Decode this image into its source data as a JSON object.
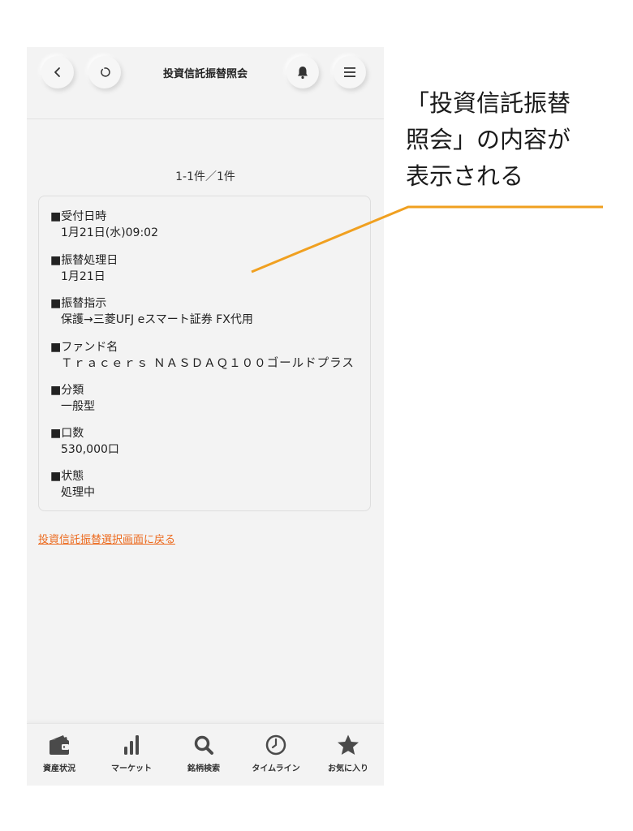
{
  "header": {
    "title": "投資信託振替照会",
    "back_icon": "chevron-left-icon",
    "reload_icon": "reload-icon",
    "bell_icon": "bell-icon",
    "menu_icon": "hamburger-menu-icon"
  },
  "result_count": "1-1件／1件",
  "details": {
    "received_label": "■受付日時",
    "received_value": "1月21日(水)09:02",
    "transfer_date_label": "■振替処理日",
    "transfer_date_value": "1月21日",
    "instruction_label": "■振替指示",
    "instruction_value": "保護→三菱UFJ eスマート証券 FX代用",
    "fund_label": "■ファンド名",
    "fund_value": "Ｔｒａｃｅｒｓ ＮＡＳＤＡＱ１００ゴールドプラス",
    "category_label": "■分類",
    "category_value": "一般型",
    "units_label": "■口数",
    "units_value": "530,000口",
    "status_label": "■状態",
    "status_value": "処理中"
  },
  "back_link": "投資信託振替選択画面に戻る",
  "tabbar": {
    "items": [
      {
        "label": "資産状況",
        "icon": "wallet-icon"
      },
      {
        "label": "マーケット",
        "icon": "bar-chart-icon"
      },
      {
        "label": "銘柄検索",
        "icon": "search-icon"
      },
      {
        "label": "タイムライン",
        "icon": "clock-icon"
      },
      {
        "label": "お気に入り",
        "icon": "star-icon"
      }
    ]
  },
  "annotation": "「投資信託振替\n照会」の内容が\n表示される",
  "colors": {
    "accent": "#ec6a1e",
    "callout_line": "#f0a020",
    "background": "#f3f3f3"
  }
}
